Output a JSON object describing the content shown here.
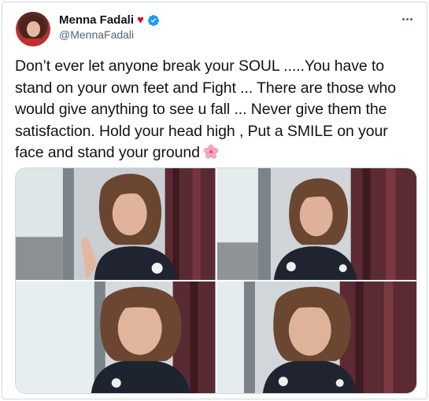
{
  "author": {
    "display_name": "Menna Fadali",
    "name_emoji": "♥",
    "handle": "@MennaFadali",
    "verified": true
  },
  "tweet": {
    "text": "Don’t ever let anyone break your SOUL .....You have to stand on your own feet and Fight ... There are those who would give anything to see u fall ...  Never give them the satisfaction. Hold your head high , Put a SMILE on your face and stand your ground",
    "trailing_emoji": "cherry-blossom-icon"
  },
  "media": {
    "count": 4,
    "photos": [
      {
        "id": "photo-1",
        "pose": "waving"
      },
      {
        "id": "photo-2",
        "pose": "smiling"
      },
      {
        "id": "photo-3",
        "pose": "close-up"
      },
      {
        "id": "photo-4",
        "pose": "close-up"
      }
    ]
  },
  "colors": {
    "text": "#0f1419",
    "secondary": "#536471",
    "verified_blue": "#1d9bf0",
    "border": "#cfd9de",
    "heart": "#d3122a"
  },
  "icons": [
    "verified-badge-icon",
    "more-options-icon",
    "cherry-blossom-icon"
  ]
}
